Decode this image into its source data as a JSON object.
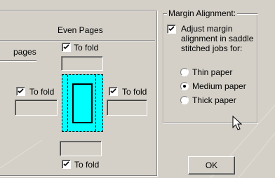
{
  "even_pages": {
    "title": "Even Pages",
    "pages_label": "pages",
    "top_fold": {
      "label": "To fold",
      "checked": true
    },
    "left_fold": {
      "label": "To fold",
      "checked": true
    },
    "right_fold": {
      "label": "To fold",
      "checked": true
    },
    "bottom_fold": {
      "label": "To fold",
      "checked": true
    }
  },
  "margin_alignment": {
    "title": "Margin Alignment:",
    "adjust": {
      "label_lines": [
        "Adjust margin",
        "alignment in saddle",
        "stitched jobs for:"
      ],
      "checked": true
    },
    "options": [
      {
        "label": "Thin paper",
        "selected": false
      },
      {
        "label": "Medium paper",
        "selected": true
      },
      {
        "label": "Thick paper",
        "selected": false
      }
    ]
  },
  "ok_button": {
    "label": "OK"
  },
  "colors": {
    "preview_fill": "#00ffff",
    "dialog_bg": "#d4d0c8"
  }
}
